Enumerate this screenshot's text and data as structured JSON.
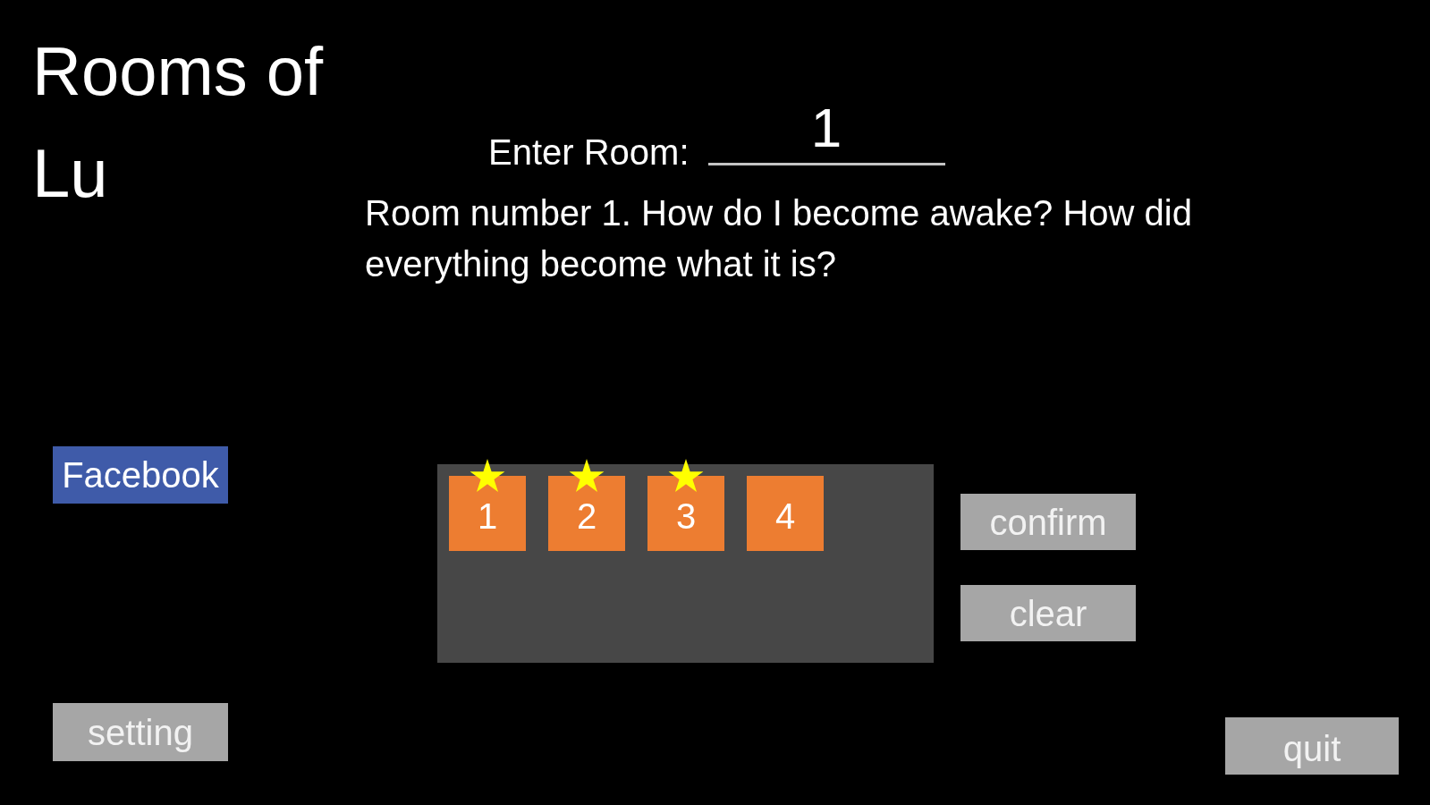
{
  "title": "Rooms of Lu",
  "enter_room": {
    "label": "Enter Room:",
    "value": "1"
  },
  "description": "Room number 1. How do I become awake? How did everything become what it is?",
  "facebook_button": "Facebook",
  "tiles": [
    {
      "label": "1",
      "starred": true
    },
    {
      "label": "2",
      "starred": true
    },
    {
      "label": "3",
      "starred": true
    },
    {
      "label": "4",
      "starred": false
    }
  ],
  "panel_buttons": [
    "confirm",
    "clear"
  ],
  "setting_button": "setting",
  "quit_button": "quit"
}
